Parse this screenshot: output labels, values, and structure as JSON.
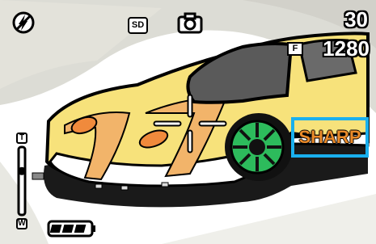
{
  "osd": {
    "flash_icon": "flash-off-icon",
    "storage_label": "SD",
    "camera_icon": "still-camera-icon",
    "shot_count": "30",
    "quality_label": "F",
    "image_size": "1280",
    "sharpness_label": "SHARP",
    "zoom_tele_label": "T",
    "zoom_wide_label": "W",
    "zoom_level": 0.33,
    "battery_icon": "battery-full-icon",
    "battery_level": 1.0
  },
  "colors": {
    "highlight_border": "#1ab0ee",
    "sharp_text": "#e98a2a",
    "car_body": "#f7e27b",
    "wheel": "#2dbb5c"
  }
}
